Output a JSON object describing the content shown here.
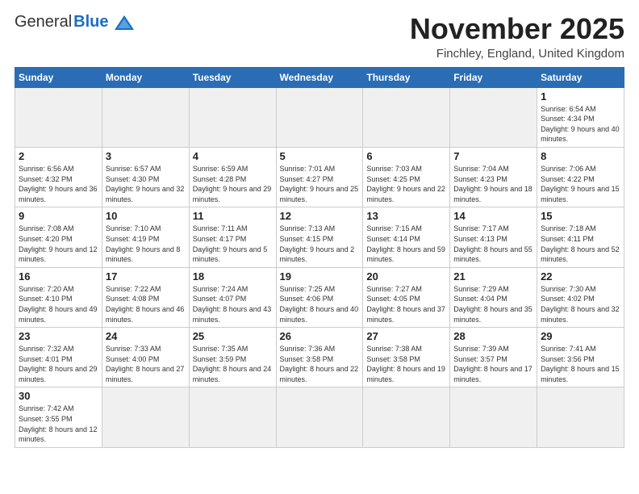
{
  "header": {
    "logo_general": "General",
    "logo_blue": "Blue",
    "month_title": "November 2025",
    "location": "Finchley, England, United Kingdom"
  },
  "weekdays": [
    "Sunday",
    "Monday",
    "Tuesday",
    "Wednesday",
    "Thursday",
    "Friday",
    "Saturday"
  ],
  "weeks": [
    [
      {
        "day": "",
        "info": ""
      },
      {
        "day": "",
        "info": ""
      },
      {
        "day": "",
        "info": ""
      },
      {
        "day": "",
        "info": ""
      },
      {
        "day": "",
        "info": ""
      },
      {
        "day": "",
        "info": ""
      },
      {
        "day": "1",
        "info": "Sunrise: 6:54 AM\nSunset: 4:34 PM\nDaylight: 9 hours and 40 minutes."
      }
    ],
    [
      {
        "day": "2",
        "info": "Sunrise: 6:56 AM\nSunset: 4:32 PM\nDaylight: 9 hours and 36 minutes."
      },
      {
        "day": "3",
        "info": "Sunrise: 6:57 AM\nSunset: 4:30 PM\nDaylight: 9 hours and 32 minutes."
      },
      {
        "day": "4",
        "info": "Sunrise: 6:59 AM\nSunset: 4:28 PM\nDaylight: 9 hours and 29 minutes."
      },
      {
        "day": "5",
        "info": "Sunrise: 7:01 AM\nSunset: 4:27 PM\nDaylight: 9 hours and 25 minutes."
      },
      {
        "day": "6",
        "info": "Sunrise: 7:03 AM\nSunset: 4:25 PM\nDaylight: 9 hours and 22 minutes."
      },
      {
        "day": "7",
        "info": "Sunrise: 7:04 AM\nSunset: 4:23 PM\nDaylight: 9 hours and 18 minutes."
      },
      {
        "day": "8",
        "info": "Sunrise: 7:06 AM\nSunset: 4:22 PM\nDaylight: 9 hours and 15 minutes."
      }
    ],
    [
      {
        "day": "9",
        "info": "Sunrise: 7:08 AM\nSunset: 4:20 PM\nDaylight: 9 hours and 12 minutes."
      },
      {
        "day": "10",
        "info": "Sunrise: 7:10 AM\nSunset: 4:19 PM\nDaylight: 9 hours and 8 minutes."
      },
      {
        "day": "11",
        "info": "Sunrise: 7:11 AM\nSunset: 4:17 PM\nDaylight: 9 hours and 5 minutes."
      },
      {
        "day": "12",
        "info": "Sunrise: 7:13 AM\nSunset: 4:15 PM\nDaylight: 9 hours and 2 minutes."
      },
      {
        "day": "13",
        "info": "Sunrise: 7:15 AM\nSunset: 4:14 PM\nDaylight: 8 hours and 59 minutes."
      },
      {
        "day": "14",
        "info": "Sunrise: 7:17 AM\nSunset: 4:13 PM\nDaylight: 8 hours and 55 minutes."
      },
      {
        "day": "15",
        "info": "Sunrise: 7:18 AM\nSunset: 4:11 PM\nDaylight: 8 hours and 52 minutes."
      }
    ],
    [
      {
        "day": "16",
        "info": "Sunrise: 7:20 AM\nSunset: 4:10 PM\nDaylight: 8 hours and 49 minutes."
      },
      {
        "day": "17",
        "info": "Sunrise: 7:22 AM\nSunset: 4:08 PM\nDaylight: 8 hours and 46 minutes."
      },
      {
        "day": "18",
        "info": "Sunrise: 7:24 AM\nSunset: 4:07 PM\nDaylight: 8 hours and 43 minutes."
      },
      {
        "day": "19",
        "info": "Sunrise: 7:25 AM\nSunset: 4:06 PM\nDaylight: 8 hours and 40 minutes."
      },
      {
        "day": "20",
        "info": "Sunrise: 7:27 AM\nSunset: 4:05 PM\nDaylight: 8 hours and 37 minutes."
      },
      {
        "day": "21",
        "info": "Sunrise: 7:29 AM\nSunset: 4:04 PM\nDaylight: 8 hours and 35 minutes."
      },
      {
        "day": "22",
        "info": "Sunrise: 7:30 AM\nSunset: 4:02 PM\nDaylight: 8 hours and 32 minutes."
      }
    ],
    [
      {
        "day": "23",
        "info": "Sunrise: 7:32 AM\nSunset: 4:01 PM\nDaylight: 8 hours and 29 minutes."
      },
      {
        "day": "24",
        "info": "Sunrise: 7:33 AM\nSunset: 4:00 PM\nDaylight: 8 hours and 27 minutes."
      },
      {
        "day": "25",
        "info": "Sunrise: 7:35 AM\nSunset: 3:59 PM\nDaylight: 8 hours and 24 minutes."
      },
      {
        "day": "26",
        "info": "Sunrise: 7:36 AM\nSunset: 3:58 PM\nDaylight: 8 hours and 22 minutes."
      },
      {
        "day": "27",
        "info": "Sunrise: 7:38 AM\nSunset: 3:58 PM\nDaylight: 8 hours and 19 minutes."
      },
      {
        "day": "28",
        "info": "Sunrise: 7:39 AM\nSunset: 3:57 PM\nDaylight: 8 hours and 17 minutes."
      },
      {
        "day": "29",
        "info": "Sunrise: 7:41 AM\nSunset: 3:56 PM\nDaylight: 8 hours and 15 minutes."
      }
    ],
    [
      {
        "day": "30",
        "info": "Sunrise: 7:42 AM\nSunset: 3:55 PM\nDaylight: 8 hours and 12 minutes."
      },
      {
        "day": "",
        "info": ""
      },
      {
        "day": "",
        "info": ""
      },
      {
        "day": "",
        "info": ""
      },
      {
        "day": "",
        "info": ""
      },
      {
        "day": "",
        "info": ""
      },
      {
        "day": "",
        "info": ""
      }
    ]
  ]
}
